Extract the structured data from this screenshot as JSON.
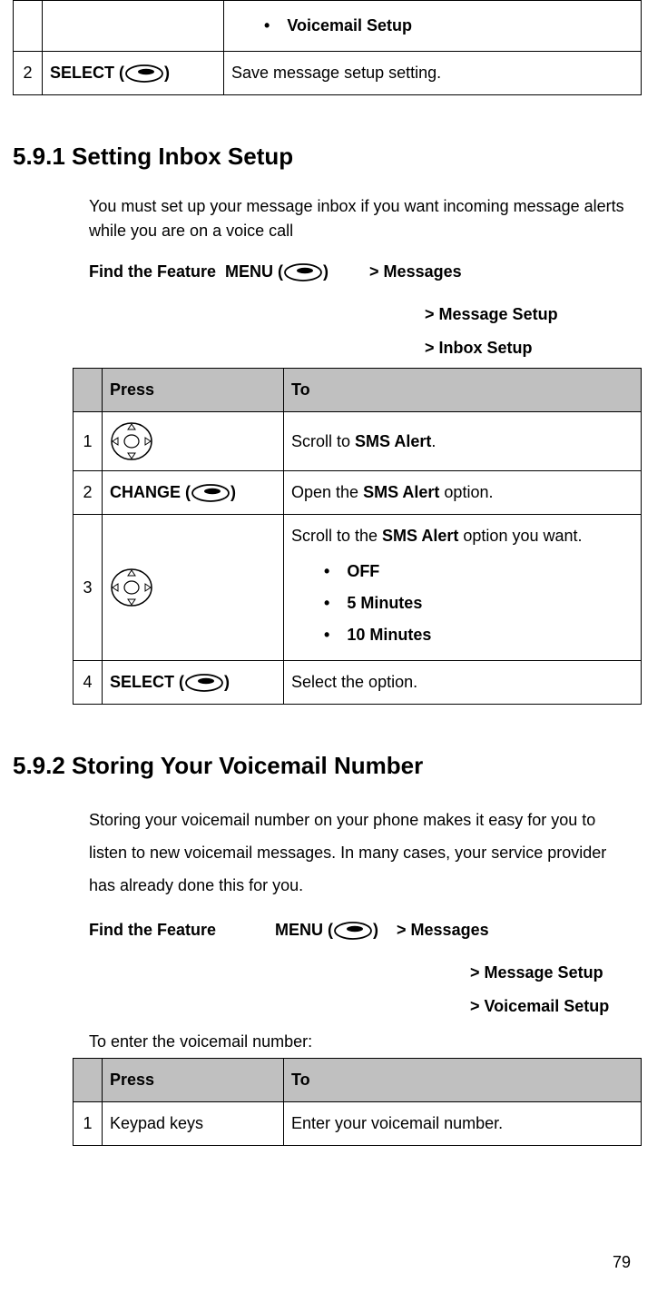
{
  "topTable": {
    "row1": {
      "bullet1": "Voicemail Setup"
    },
    "row2": {
      "num": "2",
      "press_label": "SELECT",
      "to": "Save message setup setting."
    }
  },
  "sec591": {
    "heading": "5.9.1    Setting Inbox Setup",
    "intro": "You must set up your message inbox if you want incoming message alerts while you are on a voice call",
    "feature_label": "Find the Feature",
    "menu_label": "MENU",
    "bc1": "> Messages",
    "bc2": "> Message Setup",
    "bc3": "> Inbox Setup",
    "table": {
      "h_press": "Press",
      "h_to": "To",
      "r1": {
        "num": "1",
        "to_pre": "Scroll to ",
        "to_bold": "SMS Alert",
        "to_post": "."
      },
      "r2": {
        "num": "2",
        "press_label": "CHANGE",
        "to_pre": "Open the ",
        "to_bold": "SMS Alert",
        "to_post": " option."
      },
      "r3": {
        "num": "3",
        "to_pre": "Scroll to the ",
        "to_bold": "SMS Alert",
        "to_post": " option you want.",
        "b1": "OFF",
        "b2": "5 Minutes",
        "b3": "10 Minutes"
      },
      "r4": {
        "num": "4",
        "press_label": "SELECT",
        "to": "Select the option."
      }
    }
  },
  "sec592": {
    "heading": "5.9.2    Storing Your Voicemail Number",
    "intro": "Storing your voicemail number on your phone makes it easy for you to listen to new voicemail messages. In many cases, your service provider has already done this for you.",
    "feature_label": "Find the Feature",
    "menu_label": "MENU",
    "bc1": "> Messages",
    "bc2": "> Message Setup",
    "bc3": "> Voicemail Setup",
    "enter_line": "To enter the voicemail number:",
    "table": {
      "h_press": "Press",
      "h_to": "To",
      "r1": {
        "num": "1",
        "press": "Keypad keys",
        "to": "Enter your voicemail number."
      }
    }
  },
  "page": "79"
}
